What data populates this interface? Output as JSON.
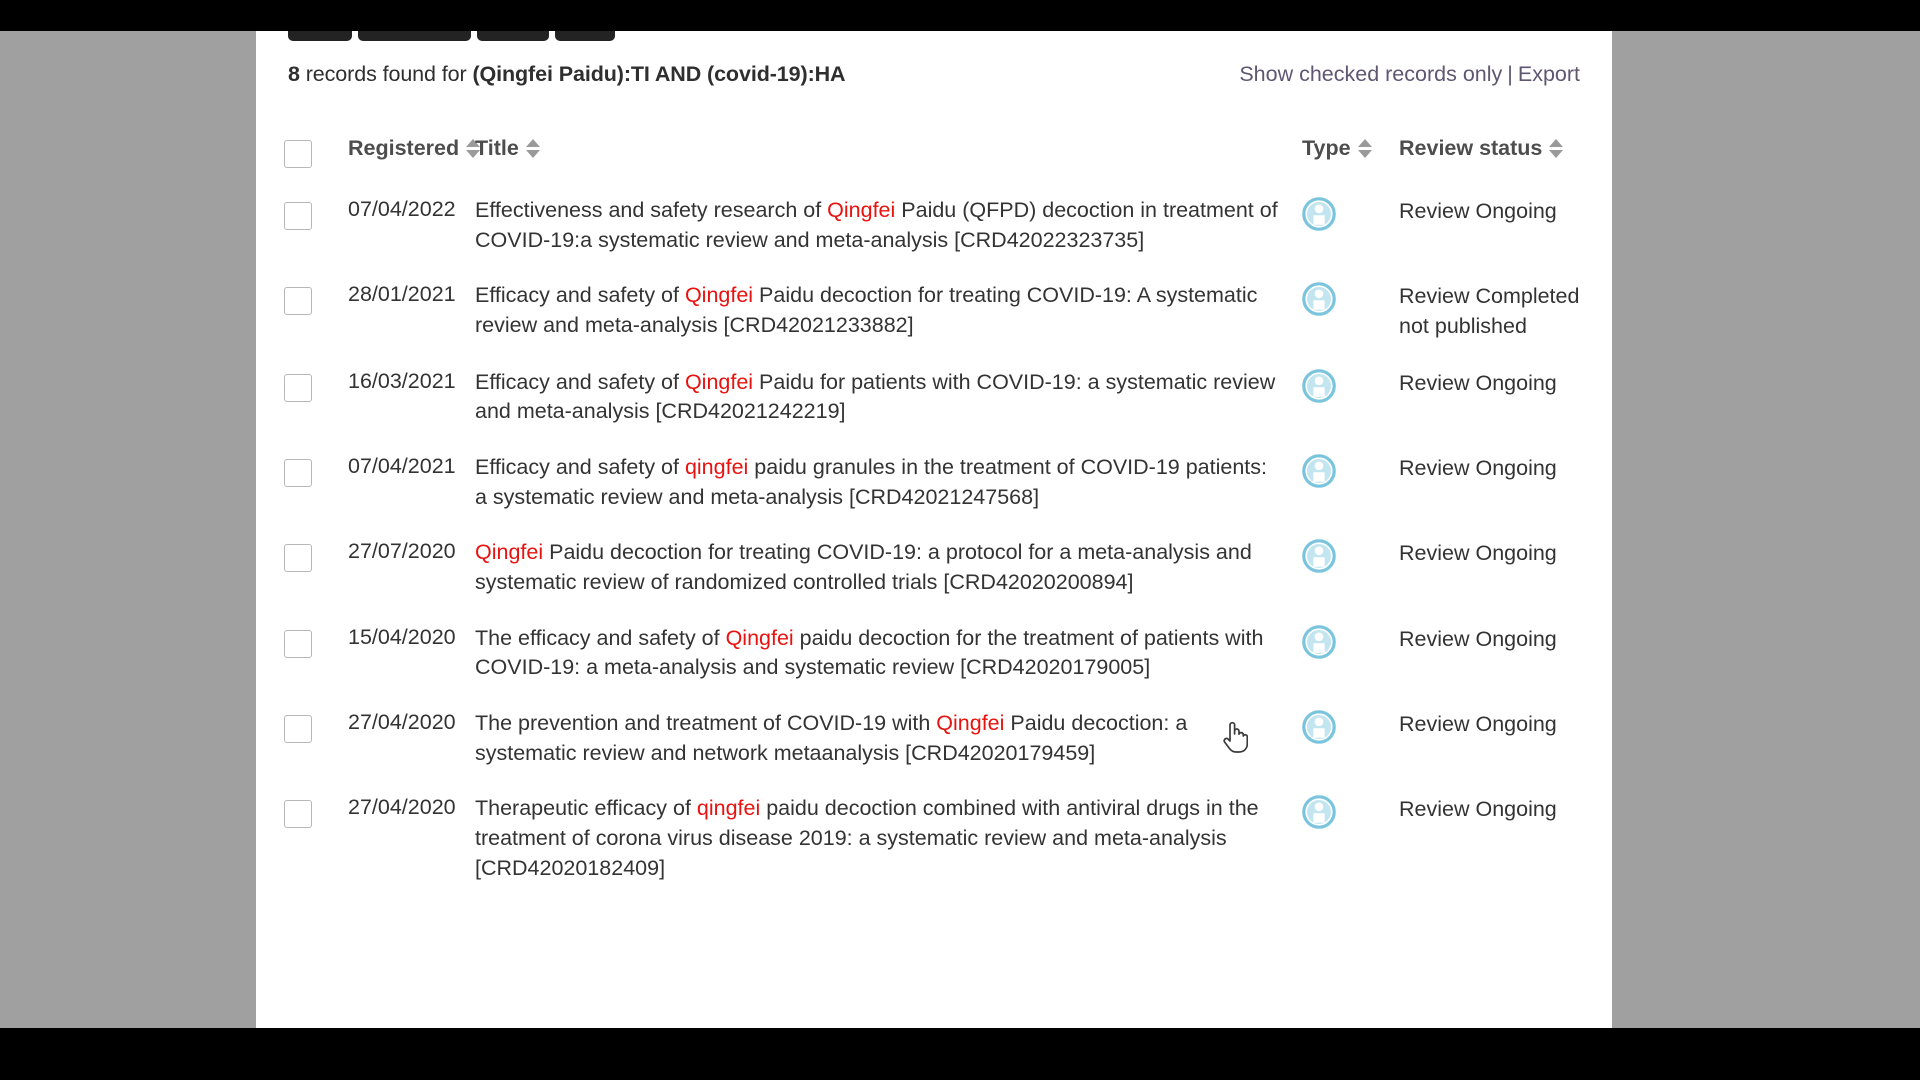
{
  "header": {
    "count_number": "8",
    "count_text": " records found for ",
    "query": "(Qingfei Paidu):TI AND (covid-19):HA",
    "show_checked_link": "Show checked records only",
    "separator": "|",
    "export_link": "Export"
  },
  "toolbar": {
    "partial_label": "..."
  },
  "columns": {
    "select_all": "",
    "registered": "Registered",
    "title": "Title",
    "type": "Type",
    "review_status": "Review status"
  },
  "icons": {
    "sort": "sort-ascending-descending-icon",
    "type": "person-record-icon",
    "cursor": "pointer-hand-cursor"
  },
  "colors": {
    "highlight": "#e8120f",
    "link": "#5f5772",
    "type_icon": "#7ac5dd",
    "page_background": "#ffffff",
    "gutter": "#a0a0a0"
  },
  "rows": [
    {
      "registered": "07/04/2022",
      "title_parts": [
        {
          "t": "Effectiveness and safety research of ",
          "hl": false
        },
        {
          "t": "Qingfei",
          "hl": true
        },
        {
          "t": " Paidu (QFPD) decoction in treatment of COVID-19:a systematic review and meta-analysis [CRD42022323735]",
          "hl": false
        }
      ],
      "type": "person-record-icon",
      "status": "Review Ongoing"
    },
    {
      "registered": "28/01/2021",
      "title_parts": [
        {
          "t": "Efficacy and safety of ",
          "hl": false
        },
        {
          "t": "Qingfei",
          "hl": true
        },
        {
          "t": " Paidu decoction for treating COVID-19: A systematic review and meta-analysis [CRD42021233882]",
          "hl": false
        }
      ],
      "type": "person-record-icon",
      "status": "Review Completed not published"
    },
    {
      "registered": "16/03/2021",
      "title_parts": [
        {
          "t": "Efficacy and safety of ",
          "hl": false
        },
        {
          "t": "Qingfei",
          "hl": true
        },
        {
          "t": " Paidu for patients with COVID-19: a systematic review and meta-analysis [CRD42021242219]",
          "hl": false
        }
      ],
      "type": "person-record-icon",
      "status": "Review Ongoing"
    },
    {
      "registered": "07/04/2021",
      "title_parts": [
        {
          "t": "Efficacy and safety of ",
          "hl": false
        },
        {
          "t": "qingfei",
          "hl": true
        },
        {
          "t": " paidu granules in the treatment of COVID-19 patients: a systematic review and meta-analysis [CRD42021247568]",
          "hl": false
        }
      ],
      "type": "person-record-icon",
      "status": "Review Ongoing"
    },
    {
      "registered": "27/07/2020",
      "title_parts": [
        {
          "t": "Qingfei",
          "hl": true
        },
        {
          "t": " Paidu decoction for treating COVID-19: a protocol for a meta-analysis and systematic review of randomized controlled trials [CRD42020200894]",
          "hl": false
        }
      ],
      "type": "person-record-icon",
      "status": "Review Ongoing"
    },
    {
      "registered": "15/04/2020",
      "title_parts": [
        {
          "t": "The efficacy and safety of ",
          "hl": false
        },
        {
          "t": "Qingfei",
          "hl": true
        },
        {
          "t": " paidu decoction for the treatment of patients with COVID-19: a meta-analysis and systematic review [CRD42020179005]",
          "hl": false
        }
      ],
      "type": "person-record-icon",
      "status": "Review Ongoing"
    },
    {
      "registered": "27/04/2020",
      "title_parts": [
        {
          "t": "The prevention and treatment of COVID-19 with ",
          "hl": false
        },
        {
          "t": "Qingfei",
          "hl": true
        },
        {
          "t": " Paidu decoction: a systematic review and network metaanalysis [CRD42020179459]",
          "hl": false
        }
      ],
      "type": "person-record-icon",
      "status": "Review Ongoing"
    },
    {
      "registered": "27/04/2020",
      "title_parts": [
        {
          "t": "Therapeutic efficacy of ",
          "hl": false
        },
        {
          "t": "qingfei",
          "hl": true
        },
        {
          "t": " paidu decoction combined with antiviral drugs in the treatment of corona virus disease 2019: a systematic review and meta-analysis [CRD42020182409]",
          "hl": false
        }
      ],
      "type": "person-record-icon",
      "status": "Review Ongoing"
    }
  ]
}
